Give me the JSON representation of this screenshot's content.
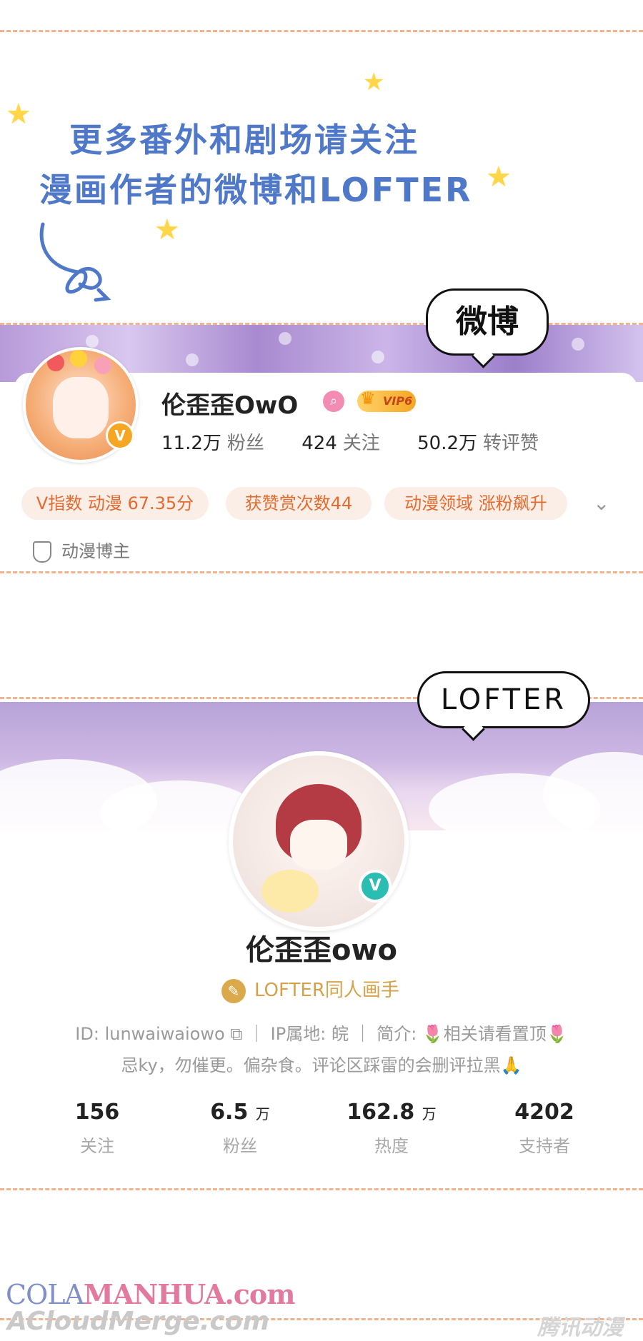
{
  "intro": {
    "line1": "更多番外和剧场请关注",
    "line2": "漫画作者的微博和LOFTER"
  },
  "weibo": {
    "bubble_label": "微博",
    "name": "伦歪歪OwO",
    "vip_label": "VIP6",
    "stats": [
      {
        "value": "11.2万",
        "label": "粉丝"
      },
      {
        "value": "424",
        "label": "关注"
      },
      {
        "value": "50.2万",
        "label": "转评赞"
      }
    ],
    "pills": [
      "V指数 动漫 67.35分",
      "获赞赏次数44",
      "动漫领域 涨粉飙升"
    ],
    "tag": "动漫博主"
  },
  "lofter": {
    "bubble_label": "LOFTER",
    "name": "伦歪歪owo",
    "role": "LOFTER同人画手",
    "id_line": "ID: lunwaiwaiowo ⧉  ｜  IP属地:   皖   ｜  简介: 🌷相关请看置顶🌷",
    "bio_line": "忌ky，勿催更。偏杂食。评论区踩雷的会删评拉黑🙏",
    "stats": [
      {
        "value": "156",
        "unit": "",
        "label": "关注"
      },
      {
        "value": "6.5",
        "unit": "万",
        "label": "粉丝"
      },
      {
        "value": "162.8",
        "unit": "万",
        "label": "热度"
      },
      {
        "value": "4202",
        "unit": "",
        "label": "支持者"
      }
    ]
  },
  "watermarks": {
    "site1_a": "COLA",
    "site1_b": "MANHUA.com",
    "site2": "ACloudMerge.com",
    "corner": "腾讯动漫"
  },
  "colors": {
    "accent_orange": "#e46b2f",
    "intro_blue": "#4f78c9",
    "dash": "#f2b38c",
    "lofter_teal": "#2bbcb2"
  }
}
